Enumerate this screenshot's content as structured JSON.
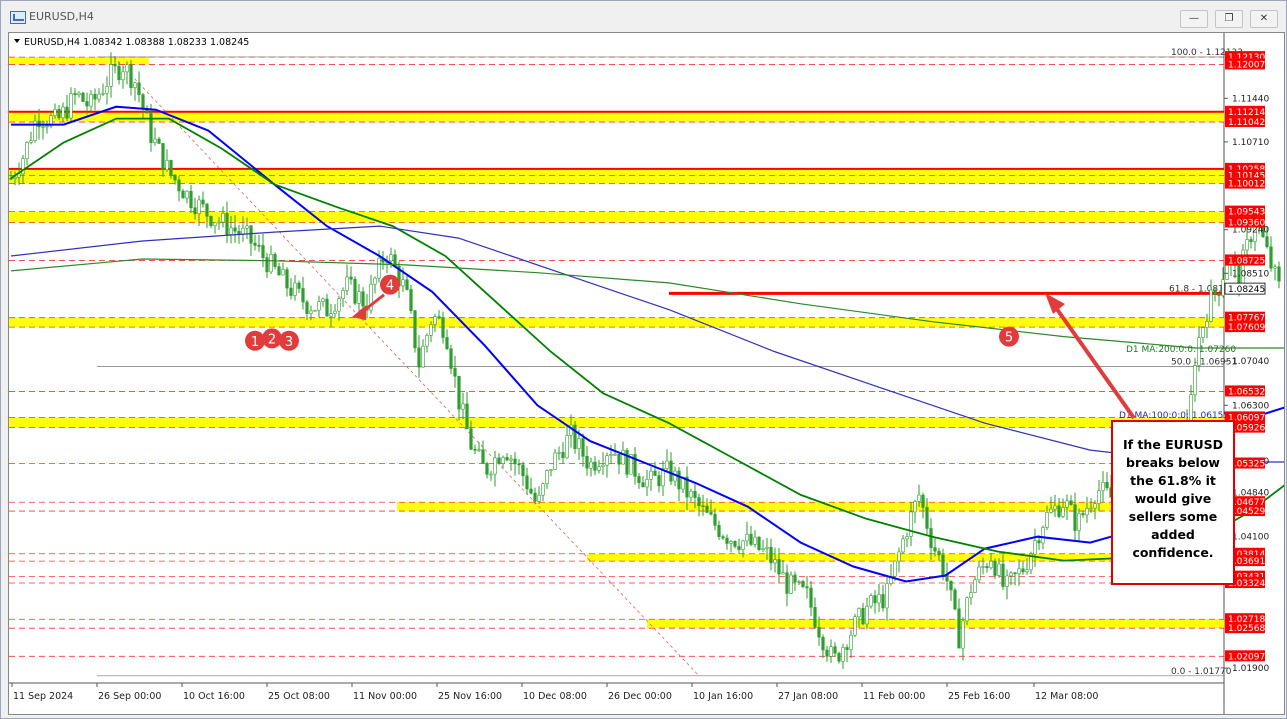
{
  "window": {
    "title": "EURUSD,H4",
    "buttons": {
      "minimize": "—",
      "restore": "❐",
      "close": "✕"
    }
  },
  "colors": {
    "zone": "#ffff00",
    "red_line": "#ff0000",
    "dashed_red": "#ff3333",
    "price_tag": "#ff0000",
    "ma_blue": "#0000ff",
    "ma_green": "#008000",
    "candle": "#2e9e2e",
    "callout_border": "#e00000"
  },
  "chart_data": {
    "type": "candlestick",
    "symbol_line": "EURUSD,H4  1.08342 1.08388 1.08233 1.08245",
    "ylim": [
      1.0165,
      1.125
    ],
    "x_labels": [
      "11 Sep 2024",
      "26 Sep 00:00",
      "10 Oct 16:00",
      "25 Oct 08:00",
      "11 Nov 00:00",
      "25 Nov 16:00",
      "10 Dec 08:00",
      "26 Dec 00:00",
      "10 Jan 16:00",
      "27 Jan 08:00",
      "11 Feb 00:00",
      "25 Feb 16:00",
      "12 Mar 08:00"
    ],
    "y_ticks": [
      "1.11440",
      "1.10710",
      "1.09240",
      "1.08510",
      "1.07040",
      "1.06300",
      "1.05370",
      "1.04840",
      "1.04100",
      "1.01900"
    ],
    "red_price_tags": [
      "1.12130",
      "1.12007",
      "1.11214",
      "1.11042",
      "1.10258",
      "1.10145",
      "1.10012",
      "1.09543",
      "1.09360",
      "1.08725",
      "1.07767",
      "1.07609",
      "1.06532",
      "1.06097",
      "1.05926",
      "1.05325",
      "1.04677",
      "1.04529",
      "1.03814",
      "1.03691",
      "1.03431",
      "1.03324",
      "1.02718",
      "1.02568",
      "1.02097"
    ],
    "current_price": "1.08245",
    "fib_labels": [
      "100.0 - 1.12133",
      "61.8 - 1.08174",
      "50.0 - 1.06951",
      "0.0 - 1.01770"
    ],
    "ma_labels": [
      "D1 MA:200:0:0: 1.07260",
      "D1 MA:100:0:0: 1.06155"
    ],
    "wave_markers": [
      "1",
      "2",
      "3",
      "4",
      "5"
    ],
    "close_path": [
      [
        0,
        1.101
      ],
      [
        0.01,
        1.105
      ],
      [
        0.02,
        1.1115
      ],
      [
        0.035,
        1.1105
      ],
      [
        0.05,
        1.115
      ],
      [
        0.06,
        1.113
      ],
      [
        0.075,
        1.118
      ],
      [
        0.085,
        1.12
      ],
      [
        0.095,
        1.117
      ],
      [
        0.105,
        1.109
      ],
      [
        0.12,
        1.102
      ],
      [
        0.135,
        1.098
      ],
      [
        0.15,
        1.095
      ],
      [
        0.165,
        1.093
      ],
      [
        0.18,
        1.091
      ],
      [
        0.195,
        1.087
      ],
      [
        0.21,
        1.083
      ],
      [
        0.225,
        1.08
      ],
      [
        0.24,
        1.079
      ],
      [
        0.255,
        1.083
      ],
      [
        0.27,
        1.08
      ],
      [
        0.285,
        1.089
      ],
      [
        0.3,
        1.082
      ],
      [
        0.31,
        1.07
      ],
      [
        0.32,
        1.078
      ],
      [
        0.33,
        1.076
      ],
      [
        0.34,
        1.064
      ],
      [
        0.35,
        1.056
      ],
      [
        0.36,
        1.052
      ],
      [
        0.375,
        1.056
      ],
      [
        0.39,
        1.051
      ],
      [
        0.4,
        1.046
      ],
      [
        0.41,
        1.053
      ],
      [
        0.425,
        1.058
      ],
      [
        0.44,
        1.053
      ],
      [
        0.455,
        1.056
      ],
      [
        0.47,
        1.053
      ],
      [
        0.485,
        1.05
      ],
      [
        0.5,
        1.052
      ],
      [
        0.515,
        1.048
      ],
      [
        0.53,
        1.044
      ],
      [
        0.545,
        1.041
      ],
      [
        0.56,
        1.04
      ],
      [
        0.575,
        1.038
      ],
      [
        0.59,
        1.033
      ],
      [
        0.605,
        1.031
      ],
      [
        0.615,
        1.025
      ],
      [
        0.625,
        1.02
      ],
      [
        0.635,
        1.024
      ],
      [
        0.65,
        1.029
      ],
      [
        0.665,
        1.031
      ],
      [
        0.68,
        1.042
      ],
      [
        0.69,
        1.048
      ],
      [
        0.7,
        1.04
      ],
      [
        0.71,
        1.035
      ],
      [
        0.72,
        1.024
      ],
      [
        0.73,
        1.033
      ],
      [
        0.745,
        1.038
      ],
      [
        0.755,
        1.032
      ],
      [
        0.77,
        1.036
      ],
      [
        0.785,
        1.044
      ],
      [
        0.8,
        1.047
      ],
      [
        0.81,
        1.043
      ],
      [
        0.825,
        1.049
      ],
      [
        0.84,
        1.047
      ],
      [
        0.855,
        1.05
      ],
      [
        0.865,
        1.043
      ],
      [
        0.875,
        1.038
      ],
      [
        0.885,
        1.05
      ],
      [
        0.895,
        1.06
      ],
      [
        0.9,
        1.072
      ],
      [
        0.91,
        1.08
      ],
      [
        0.918,
        1.083
      ],
      [
        0.925,
        1.088
      ],
      [
        0.932,
        1.084
      ],
      [
        0.94,
        1.09
      ],
      [
        0.946,
        1.095
      ],
      [
        0.952,
        1.09
      ],
      [
        0.958,
        1.086
      ],
      [
        0.964,
        1.0824
      ]
    ]
  },
  "callout": {
    "text_lines": [
      "If the EURUSD",
      "breaks below",
      "the 61.8% it",
      "would give",
      "sellers some",
      "added",
      "confidence."
    ]
  }
}
